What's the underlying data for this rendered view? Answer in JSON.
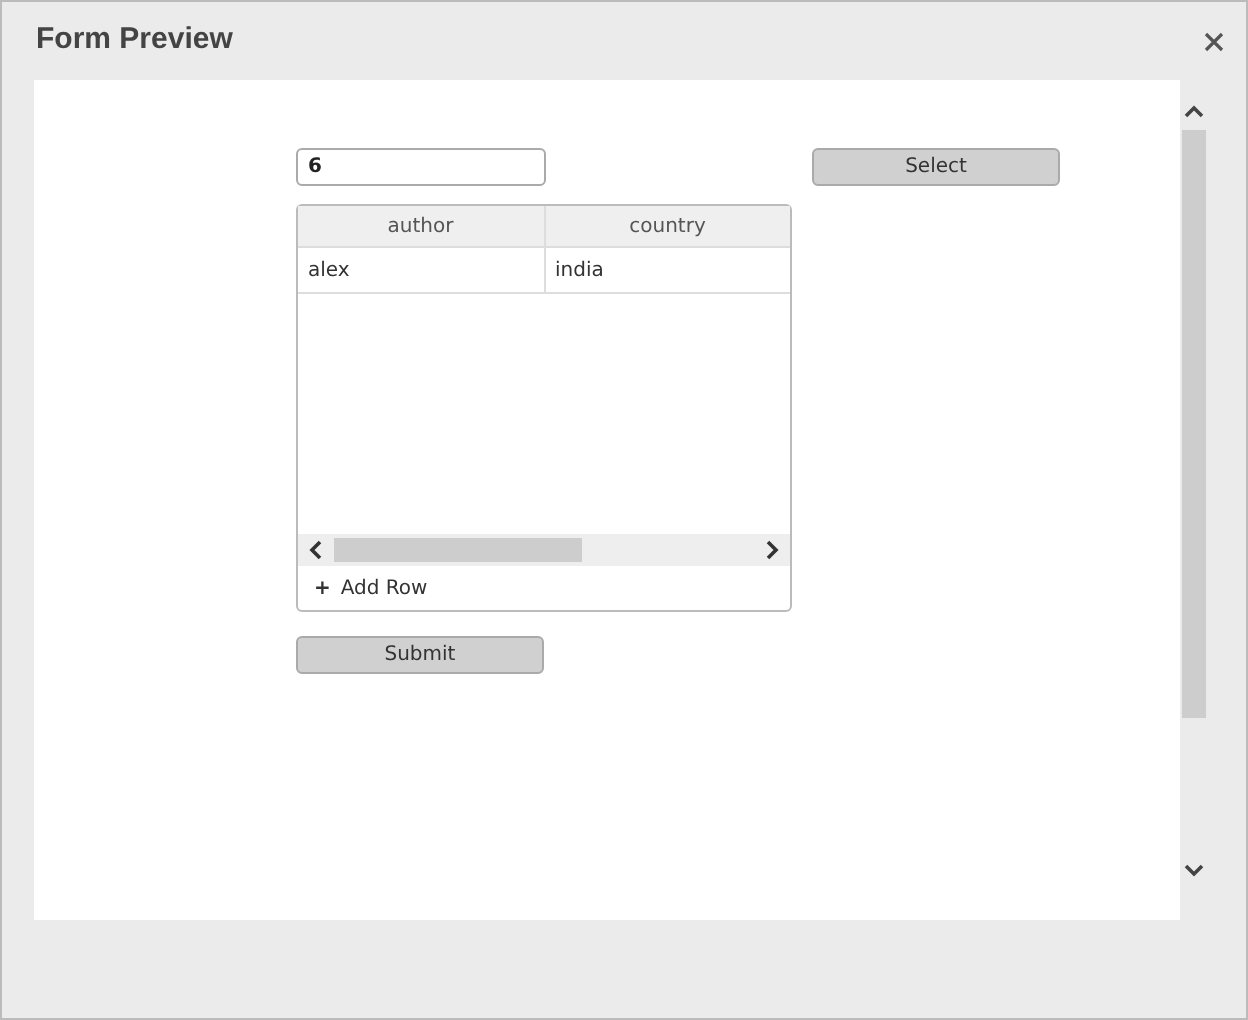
{
  "window": {
    "title": "Form Preview"
  },
  "number_field": {
    "value": "6"
  },
  "select_button": {
    "label": "Select"
  },
  "grid": {
    "columns": [
      "author",
      "country"
    ],
    "rows": [
      [
        "alex",
        "india"
      ]
    ],
    "add_row": {
      "icon": "+",
      "label": "Add Row"
    }
  },
  "submit_button": {
    "label": "Submit"
  }
}
